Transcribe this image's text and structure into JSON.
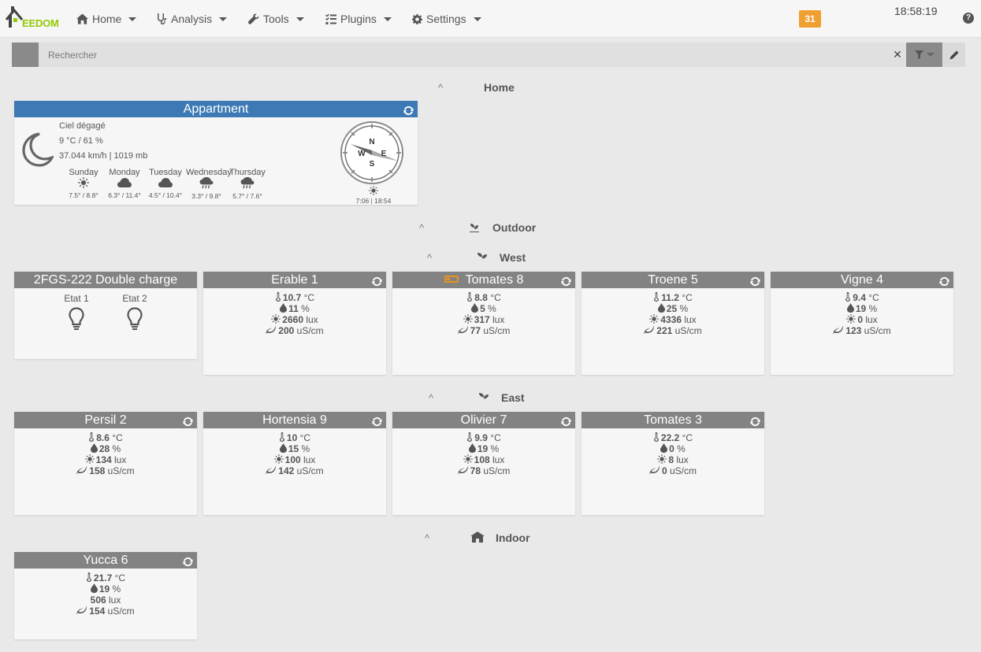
{
  "app": {
    "logo_text": "EEDOM",
    "clock": "18:58:19",
    "message_count": "31",
    "help_label": "?"
  },
  "nav": [
    {
      "label": "Home",
      "icon": "home-icon"
    },
    {
      "label": "Analysis",
      "icon": "stethoscope-icon"
    },
    {
      "label": "Tools",
      "icon": "wrench-icon"
    },
    {
      "label": "Plugins",
      "icon": "tasks-icon"
    },
    {
      "label": "Settings",
      "icon": "gear-icon"
    }
  ],
  "search": {
    "placeholder": "Rechercher",
    "clear_label": "✕"
  },
  "sections": {
    "home": "Home",
    "outdoor": "Outdoor",
    "west": "West",
    "east": "East",
    "indoor": "Indoor"
  },
  "weather": {
    "title": "Appartment",
    "condition": "Ciel dégagé",
    "temp_hum": "9 °C / 61 %",
    "wind_pressure": "37.044 km/h | 1019 mb",
    "compass": {
      "n": "N",
      "e": "E",
      "s": "S",
      "w": "W"
    },
    "days": [
      {
        "name": "Sunday",
        "temps": "7.5° / 8.8°",
        "icon": "sun-icon"
      },
      {
        "name": "Monday",
        "temps": "6.3° / 11.4°",
        "icon": "cloud-icon"
      },
      {
        "name": "Tuesday",
        "temps": "4.5° / 10.4°",
        "icon": "cloud-icon"
      },
      {
        "name": "Wednesday",
        "temps": "3.3° / 9.8°",
        "icon": "rain-icon"
      },
      {
        "name": "Thursday",
        "temps": "5.7° / 7.6°",
        "icon": "rain-icon"
      }
    ],
    "sun_times": "7:06 | 18:54"
  },
  "relay": {
    "title": "2FGS-222 Double charge",
    "state1": "Etat 1",
    "state2": "Etat 2"
  },
  "units": {
    "temp": "°C",
    "hum": "%",
    "lux": "lux",
    "cond": "uS/cm"
  },
  "plants": [
    {
      "title": "Erable 1",
      "temp": "10.7",
      "hum": "11",
      "lux": "2660",
      "cond": "200"
    },
    {
      "title": "Tomates 8",
      "temp": "8.8",
      "hum": "5",
      "lux": "317",
      "cond": "77"
    },
    {
      "title": "Troene 5",
      "temp": "11.2",
      "hum": "25",
      "lux": "4336",
      "cond": "221"
    },
    {
      "title": "Vigne 4",
      "temp": "9.4",
      "hum": "19",
      "lux": "0",
      "cond": "123"
    },
    {
      "title": "Persil 2",
      "temp": "8.6",
      "hum": "28",
      "lux": "134",
      "cond": "158"
    },
    {
      "title": "Hortensia 9",
      "temp": "10",
      "hum": "15",
      "lux": "100",
      "cond": "142"
    },
    {
      "title": "Olivier 7",
      "temp": "9.9",
      "hum": "19",
      "lux": "108",
      "cond": "78"
    },
    {
      "title": "Tomates 3",
      "temp": "22.2",
      "hum": "0",
      "lux": "8",
      "cond": "0"
    },
    {
      "title": "Yucca 6",
      "temp": "21.7",
      "hum": "19",
      "lux": "506",
      "cond": "154"
    }
  ]
}
